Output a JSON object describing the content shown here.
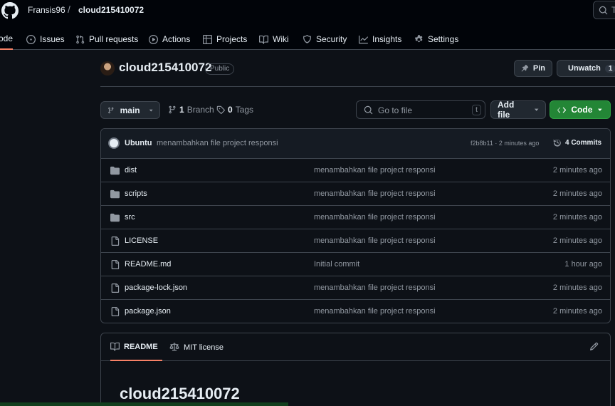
{
  "header": {
    "owner": "Fransis96",
    "separator": "/",
    "repo": "cloud215410072",
    "search_placeholder": "T"
  },
  "nav": [
    {
      "label": "ode",
      "icon": "code-icon",
      "active": true
    },
    {
      "label": "Issues",
      "icon": "issue-opened-icon"
    },
    {
      "label": "Pull requests",
      "icon": "git-pull-request-icon"
    },
    {
      "label": "Actions",
      "icon": "play-icon"
    },
    {
      "label": "Projects",
      "icon": "table-icon"
    },
    {
      "label": "Wiki",
      "icon": "book-icon"
    },
    {
      "label": "Security",
      "icon": "shield-icon"
    },
    {
      "label": "Insights",
      "icon": "graph-icon"
    },
    {
      "label": "Settings",
      "icon": "gear-icon"
    }
  ],
  "repo": {
    "title": "cloud215410072",
    "visibility": "Public",
    "pin_label": "Pin",
    "unwatch_label": "Unwatch",
    "watch_count": "1"
  },
  "toolbar": {
    "branch": "main",
    "branches_count": "1",
    "branches_label": "Branch",
    "tags_count": "0",
    "tags_label": "Tags",
    "goto_placeholder": "Go to file",
    "goto_key": "t",
    "add_file_label": "Add file",
    "code_label": "Code"
  },
  "commit": {
    "author": "Ubuntu",
    "message": "menambahkan file project responsi",
    "hash_time": "f2b8b11 · 2 minutes ago",
    "commits_label": "4 Commits"
  },
  "files": [
    {
      "name": "dist",
      "type": "folder",
      "message": "menambahkan file project responsi",
      "time": "2 minutes ago"
    },
    {
      "name": "scripts",
      "type": "folder",
      "message": "menambahkan file project responsi",
      "time": "2 minutes ago"
    },
    {
      "name": "src",
      "type": "folder",
      "message": "menambahkan file project responsi",
      "time": "2 minutes ago"
    },
    {
      "name": "LICENSE",
      "type": "file",
      "message": "menambahkan file project responsi",
      "time": "2 minutes ago"
    },
    {
      "name": "README.md",
      "type": "file",
      "message": "Initial commit",
      "time": "1 hour ago"
    },
    {
      "name": "package-lock.json",
      "type": "file",
      "message": "menambahkan file project responsi",
      "time": "2 minutes ago"
    },
    {
      "name": "package.json",
      "type": "file",
      "message": "menambahkan file project responsi",
      "time": "2 minutes ago"
    }
  ],
  "readme": {
    "tab_readme": "README",
    "tab_license": "MIT license",
    "heading": "cloud215410072"
  },
  "colors": {
    "accent_underline": "#f78166",
    "code_button": "#238636",
    "background": "#0d1117"
  }
}
